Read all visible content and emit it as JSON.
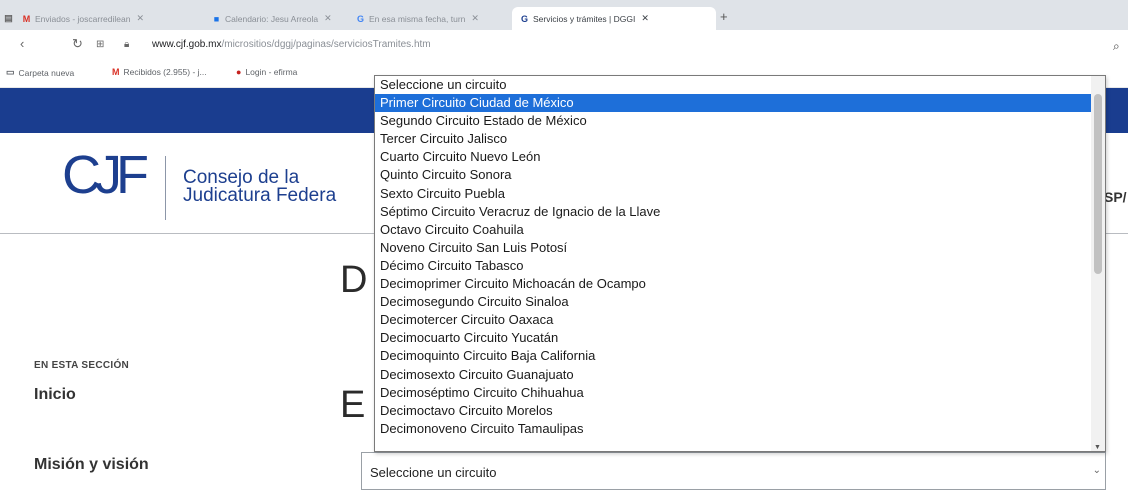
{
  "browser": {
    "tabs": [
      {
        "label": "Enviados - joscarredilean",
        "icon": "gmail-icon",
        "color": "#d93025"
      },
      {
        "label": "Calendario: Jesu Arreola",
        "icon": "calendar-icon",
        "color": "#1a73e8"
      },
      {
        "label": "En esa misma fecha, turn",
        "icon": "google-icon",
        "color": "#4285f4"
      },
      {
        "label": "Servicios y trámites | DGGI",
        "icon": "cjf-icon",
        "color": "#1d3f8f"
      }
    ],
    "url_host": "www.cjf.gob.mx",
    "url_path": "/micrositios/dggj/paginas/serviciosTramites.htm",
    "bookmarks": [
      {
        "label": "Carpeta nueva",
        "icon": "folder-icon"
      },
      {
        "label": "Recibidos (2.955) - j...",
        "icon": "gmail-icon"
      },
      {
        "label": "Login - efirma",
        "icon": "login-icon"
      }
    ]
  },
  "site": {
    "logo_mark": "CJF",
    "logo_line1": "Consejo de la",
    "logo_line2": "Judicatura Federa",
    "nav_partial": "SP/",
    "heading_d": "D",
    "heading_e": "E",
    "sidebar_heading": "EN ESTA SECCIÓN",
    "sidebar_items": [
      "Inicio",
      "Misión y visión"
    ]
  },
  "select": {
    "value": "Seleccione un circuito",
    "options": [
      "Seleccione un circuito",
      "Primer Circuito Ciudad de México",
      "Segundo Circuito Estado de México",
      "Tercer Circuito Jalisco",
      "Cuarto Circuito Nuevo León",
      "Quinto Circuito Sonora",
      "Sexto Circuito Puebla",
      "Séptimo Circuito Veracruz de Ignacio de la Llave",
      "Octavo Circuito Coahuila",
      "Noveno Circuito San Luis Potosí",
      "Décimo Circuito Tabasco",
      "Decimoprimer Circuito Michoacán de Ocampo",
      "Decimosegundo Circuito Sinaloa",
      "Decimotercer Circuito Oaxaca",
      "Decimocuarto Circuito Yucatán",
      "Decimoquinto Circuito Baja California",
      "Decimosexto Circuito Guanajuato",
      "Decimoséptimo Circuito Chihuahua",
      "Decimoctavo Circuito Morelos",
      "Decimonoveno Circuito Tamaulipas"
    ],
    "highlighted_index": 1
  },
  "colors": {
    "brand": "#1d3f8f",
    "highlight": "#1e6fd9"
  }
}
